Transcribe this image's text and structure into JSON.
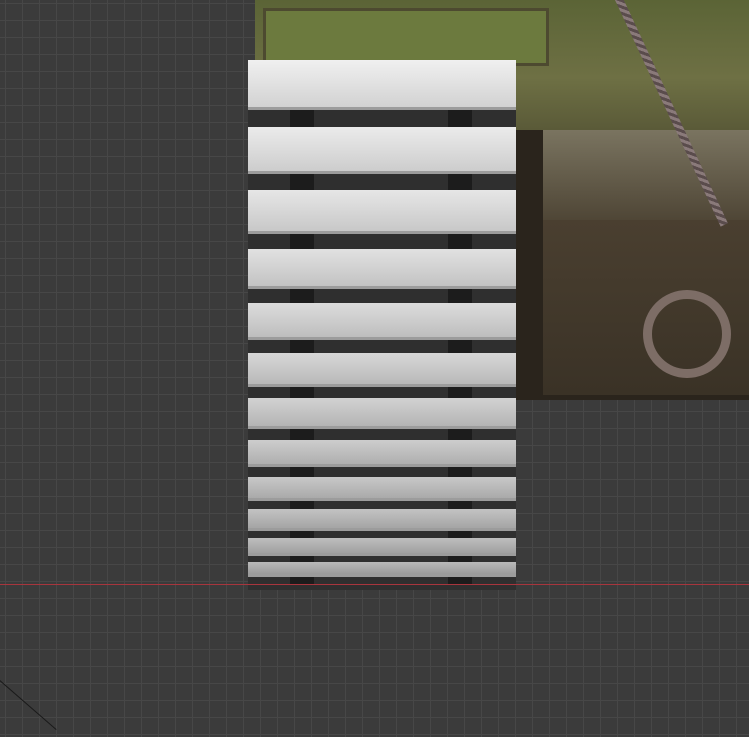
{
  "viewport": {
    "background": "#3b3b3b",
    "grid_line": "#474747",
    "x_axis_color": "#a8353d"
  },
  "scene": {
    "track_link_count": 12,
    "track_color": "#e8e8e8",
    "tank_colors": [
      "#6c7a3e",
      "#4a3f30"
    ]
  }
}
